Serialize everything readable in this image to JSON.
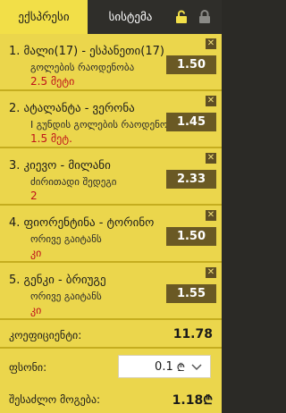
{
  "tabs": [
    {
      "label": "ექსპრესი",
      "active": true
    },
    {
      "label": "სისტემა",
      "active": false
    }
  ],
  "icons": {
    "unlock": "unlock-icon",
    "lock": "lock-icon",
    "close": "close-icon",
    "currency": "lari-currency-icon",
    "dropdown": "chevron-down-icon"
  },
  "bets": [
    {
      "number": "1.",
      "teams": "მალი(17) - ესპანეთი(17)",
      "market": "გოლების რაოდენობა",
      "pick": "2.5 მეტი",
      "odds": "1.50"
    },
    {
      "number": "2.",
      "teams": "ატალანტა - ვერონა",
      "market": "I გუნდის გოლების რაოდენობა",
      "pick": "1.5 მეტ.",
      "odds": "1.45"
    },
    {
      "number": "3.",
      "teams": "კიევო - მილანი",
      "market": "ძირითადი შედეგი",
      "pick": "2",
      "odds": "2.33"
    },
    {
      "number": "4.",
      "teams": "ფიორენტინა - ტორინო",
      "market": "ორივე გაიტანს",
      "pick": "კი",
      "odds": "1.50"
    },
    {
      "number": "5.",
      "teams": "გენკი - ბრიუგე",
      "market": "ორივე გაიტანს",
      "pick": "კი",
      "odds": "1.55"
    }
  ],
  "summary": {
    "coefficient_label": "კოეფიციენტი:",
    "coefficient_value": "11.78",
    "stake_label": "ფსონი:",
    "stake_value": "0.1",
    "currency_symbol": "₾",
    "win_label": "შესაძლო მოგება:",
    "win_value": "1.18₾"
  },
  "colors": {
    "panel": "#ebd64c",
    "tabbar": "#2f2e2a",
    "odds_bg": "#6a5924",
    "pick": "#c0121a"
  }
}
